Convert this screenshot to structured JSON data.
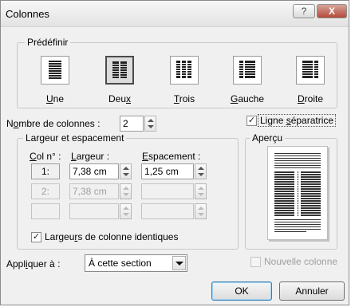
{
  "dialog": {
    "title": "Colonnes",
    "help_glyph": "?",
    "close_glyph": "X"
  },
  "presets": {
    "group_label": "Prédéfinir",
    "selected": "deux",
    "items": [
      {
        "id": "une",
        "pre": "",
        "key": "U",
        "post": "ne"
      },
      {
        "id": "deux",
        "pre": "Deu",
        "key": "x",
        "post": ""
      },
      {
        "id": "trois",
        "pre": "",
        "key": "T",
        "post": "rois"
      },
      {
        "id": "gauche",
        "pre": "",
        "key": "G",
        "post": "auche"
      },
      {
        "id": "droite",
        "pre": "",
        "key": "D",
        "post": "roite"
      }
    ]
  },
  "num_columns": {
    "label_pre": "N",
    "label_key": "o",
    "label_post": "mbre de colonnes :",
    "value": "2"
  },
  "line_between": {
    "checked": true,
    "label_pre": "Ligne ",
    "label_key": "s",
    "label_post": "éparatrice"
  },
  "width_spacing": {
    "group_label": "Largeur et espacement",
    "col_header_pre": "",
    "col_header_key": "C",
    "col_header_post": "ol n° :",
    "width_header_pre": "",
    "width_header_key": "L",
    "width_header_post": "argeur :",
    "spacing_header_pre": "",
    "spacing_header_key": "E",
    "spacing_header_post": "spacement :",
    "rows": [
      {
        "col": "1:",
        "width": "7,38 cm",
        "spacing": "1,25 cm",
        "enabled": true
      },
      {
        "col": "2:",
        "width": "7,38 cm",
        "spacing": "",
        "enabled": false
      },
      {
        "col": "",
        "width": "",
        "spacing": "",
        "enabled": false
      }
    ],
    "equal_width": {
      "checked": true,
      "label_pre": "Largeu",
      "label_key": "r",
      "label_post": "s de colonne identiques"
    }
  },
  "preview": {
    "label": "Aperçu",
    "columns": 2,
    "separator": true
  },
  "apply_to": {
    "label_pre": "Appl",
    "label_key": "i",
    "label_post": "quer à :",
    "value": "À cette section"
  },
  "new_column": {
    "checked": false,
    "enabled": false,
    "label": "Nouvelle colonne"
  },
  "buttons": {
    "ok": "OK",
    "cancel": "Annuler"
  }
}
